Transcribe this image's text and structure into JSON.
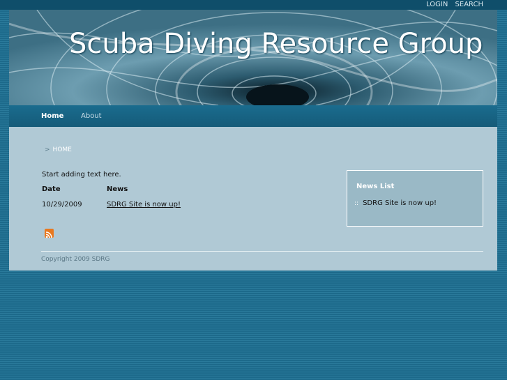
{
  "header": {
    "links": [
      "LOGIN",
      "SEARCH"
    ],
    "site_title": "Scuba Diving Resource Group"
  },
  "nav": {
    "items": [
      {
        "label": "Home",
        "active": true
      },
      {
        "label": "About",
        "active": false
      }
    ]
  },
  "breadcrumb": {
    "arrow": ">",
    "label": "HOME"
  },
  "main": {
    "intro_text": "Start adding text here.",
    "table": {
      "columns": [
        "Date",
        "News"
      ],
      "rows": [
        {
          "date": "10/29/2009",
          "news": "SDRG Site is now up!"
        }
      ]
    },
    "rss_icon": "rss-feed-icon"
  },
  "sidebar": {
    "title": "News List",
    "items": [
      "SDRG Site is now up!"
    ]
  },
  "footer": {
    "copyright": "Copyright 2009 SDRG"
  },
  "colors": {
    "page_background": "#1d6a8b",
    "content_background": "#b0c9d5",
    "nav_background": "#1a6c8e",
    "rss_orange": "#e8781f"
  }
}
